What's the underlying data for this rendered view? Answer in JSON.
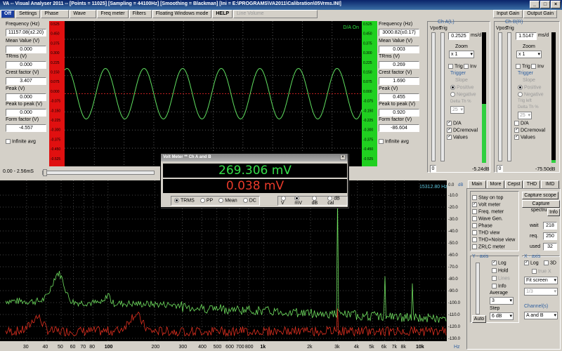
{
  "window": {
    "title": "VA -- Visual Analyser 2011 --   [Points = 11025]   [Sampling = 44100Hz]   [Smoothing = Blackman]   [Ini = E:\\PROGRAMS\\VA2011\\Calibration\\05Vrms.INI]"
  },
  "toolbar": {
    "items": [
      "Off",
      "Settings",
      "Phase",
      "Wave",
      "Freq meter",
      "Filters",
      "Floating Windows mode",
      "HELP",
      "Line Volume"
    ],
    "input_gain": "Input Gain",
    "output_gain": "Output Gain"
  },
  "left_panel": {
    "freq_label": "Frequency (Hz)",
    "freq_value": "11157.08(±2.20)",
    "mean_label": "Mean Value (V)",
    "mean_value": "0.000",
    "trms_label": "TRms (V)",
    "trms_value": "0.000",
    "crest_label": "Crest factor (V)",
    "crest_value": "3.407",
    "peak_label": "Peak (V)",
    "peak_value": "0.000",
    "p2p_label": "Peak to peak (V)",
    "p2p_value": "0.000",
    "form_label": "Form factor (V)",
    "form_value": "-4.557",
    "infinite_avg": "Infinite avg"
  },
  "right_panel": {
    "freq_label": "Frequency (Hz)",
    "freq_value": "3000.82(±0.17)",
    "mean_label": "Mean Value (V)",
    "mean_value": "0.003",
    "trms_label": "TRms (V)",
    "trms_value": "0.269",
    "crest_label": "Crest factor (V)",
    "crest_value": "1.690",
    "peak_label": "Peak (V)",
    "peak_value": "0.455",
    "p2p_label": "Peak to peak (V)",
    "p2p_value": "0.920",
    "form_label": "Form factor (V)",
    "form_value": "-86.604",
    "infinite_avg": "Infinite avg"
  },
  "scope": {
    "status": "D/A On",
    "time_range": "0.00 - 2.56mS",
    "left_ticks": [
      "0.525",
      "0.450",
      "0.375",
      "0.300",
      "0.225",
      "0.150",
      "0.075",
      "0.000",
      "-0.075",
      "-0.150",
      "-0.225",
      "-0.300",
      "-0.375",
      "-0.450",
      "-0.525"
    ],
    "right_ticks": [
      "0.525",
      "0.450",
      "0.375",
      "0.300",
      "0.225",
      "0.150",
      "0.075",
      "0.000",
      "-0.075",
      "-0.150",
      "-0.225",
      "-0.300",
      "-0.375",
      "-0.450",
      "-0.525"
    ]
  },
  "chA": {
    "title": "Ch A(L)",
    "vpos": "Vpos",
    "trig": "Trig",
    "ms_label": "ms/d",
    "ms_value": "0.2525",
    "zoom_label": "Zoom",
    "zoom_value": "x 1",
    "trig_cb": "Trig",
    "inv_cb": "Inv",
    "trigger_label": "Trigger",
    "slope_label": "Slope",
    "positive": "Positive",
    "negative": "Negative",
    "delta_label": "Delta Th %",
    "delta_value": "25",
    "da": "D/A",
    "dcremoval": "DCremoval",
    "values": "Values",
    "level": "-5.24dB",
    "zero": "0"
  },
  "chB": {
    "title": "Ch B(R)",
    "vpos": "Vpos",
    "trig": "Trig",
    "ms_label": "ms/d",
    "ms_value": "1.5147",
    "zoom_label": "Zoom",
    "zoom_value": "x 1",
    "trig_cb": "Trig",
    "inv_cb": "Inv",
    "trigger_label": "Trigger",
    "slope_label": "Slope",
    "positive": "Positive",
    "negative": "Negative",
    "trig_left": "Trig left",
    "delta_label": "Delta Th %",
    "delta_value": "25",
    "da": "D/A",
    "dcremoval": "DCremoval",
    "values": "Values",
    "level": "-75.50dB",
    "zero": "0"
  },
  "voltmeter": {
    "title": "Volt Meter ** Ch A and B",
    "value_a": "269.306 mV",
    "value_b": "0.038 mV",
    "modes": [
      "TRMS",
      "PP",
      "Mean",
      "DC"
    ],
    "units": [
      "V",
      "mV",
      "dB",
      "dB cal"
    ],
    "selected_mode": "TRMS",
    "selected_unit": "mV",
    "color_a": "#35e04a",
    "color_b": "#e83a2a"
  },
  "spectrum": {
    "peak_readout": "15312.80 Hz",
    "x_ticks": [
      "30",
      "40",
      "50",
      "60",
      "70",
      "80",
      "100",
      "200",
      "300",
      "400",
      "500",
      "600",
      "700",
      "800",
      "1k",
      "2k",
      "3k",
      "4k",
      "5k",
      "6k",
      "7k",
      "8k",
      "10k"
    ],
    "y_ticks": [
      "-10.0",
      "-20.0",
      "-30.0",
      "-40.0",
      "-50.0",
      "-60.0",
      "-70.0",
      "-80.0",
      "-90.0",
      "-100.0",
      "-110.0",
      "-120.0",
      "-130.0"
    ],
    "y_top": "0.0",
    "y_unit": "dB",
    "x_unit": "Hz"
  },
  "bottom_right": {
    "tabs": [
      "Main",
      "More",
      "Cepst",
      "THD",
      "IMD"
    ],
    "checks": [
      "Stay on top",
      "Volt meter",
      "Freq. meter",
      "Wave Gen.",
      "Phase",
      "THD view",
      "THD+Noise view",
      "ZRLC meter"
    ],
    "capture_scope": "Capture scope",
    "capture_spectrum": "Capture spectrum",
    "info": "Info",
    "wait_label": "wait",
    "wait_value": "218",
    "req_label": "req.",
    "req_value": "250",
    "used_label": "used",
    "used_value": "32",
    "y_axis_title": "Y - axis",
    "y_log": "Log",
    "y_hold": "Hold",
    "y_lines": "Lines",
    "y_info": "Info",
    "average_label": "Average",
    "average_value": "3",
    "step_label": "Step",
    "step_value": "6 dB",
    "auto": "Auto",
    "x_axis_title": "X - axis",
    "x_log": "Log",
    "x_3d": "3D",
    "x_true": "true X",
    "fit_screen": "Fit screen",
    "ratio": "1/3",
    "channels_label": "Channel(s)",
    "channels_value": "A and B"
  }
}
